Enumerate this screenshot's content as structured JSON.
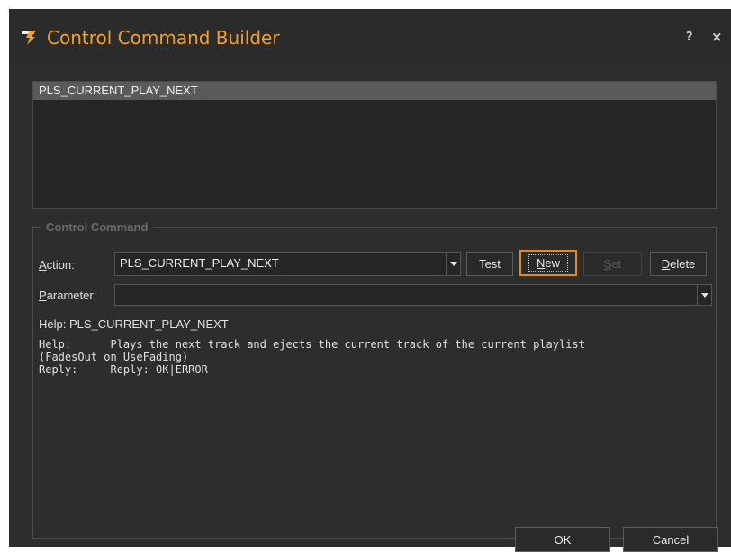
{
  "window": {
    "title": "Control Command Builder",
    "help_label": "?",
    "close_label": "×",
    "accent_color": "#f0a030"
  },
  "command_list": {
    "items": [
      "PLS_CURRENT_PLAY_NEXT"
    ]
  },
  "control_command": {
    "legend": "Control Command",
    "action_label_u": "A",
    "action_label_rest": "ction:",
    "action_value": "PLS_CURRENT_PLAY_NEXT",
    "parameter_label_u": "P",
    "parameter_label_rest": "arameter:",
    "parameter_value": "",
    "buttons": {
      "test": "Test",
      "new_u": "N",
      "new_rest": "ew",
      "set_u": "S",
      "set_rest": "et",
      "delete_u": "D",
      "delete_rest": "elete"
    },
    "help_header": "Help: PLS_CURRENT_PLAY_NEXT",
    "help_text": "Help:      Plays the next track and ejects the current track of the current playlist\n(FadesOut on UseFading)\nReply:     Reply: OK|ERROR"
  },
  "footer": {
    "ok": "OK",
    "cancel": "Cancel"
  }
}
